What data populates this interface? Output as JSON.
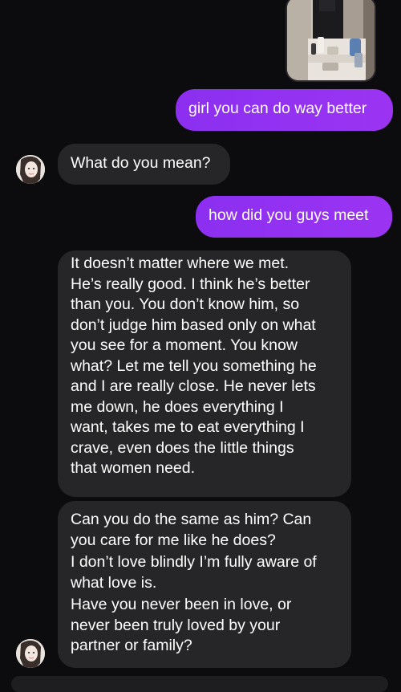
{
  "thread": {
    "messages": [
      {
        "from": "me",
        "text": "girl you can do way better"
      },
      {
        "from": "them",
        "text": "What do you mean?"
      },
      {
        "from": "me",
        "text": "how did you guys meet"
      },
      {
        "from": "them",
        "lines": [
          "It doesn’t matter where we met.",
          "He’s really good. I think he’s better",
          "than you. You don’t know him, so",
          "don’t judge him based only on what",
          "you see for a moment. You know",
          "what? Let me tell you something he",
          "and I are really close. He never lets",
          "me down, he does everything I",
          "want, takes me to eat everything I",
          "crave, even does the little things",
          "that women need."
        ]
      },
      {
        "from": "them",
        "paragraphs": [
          [
            "Can you do the same as him? Can",
            "you care for me like he does?"
          ],
          [
            "I don’t love blindly I’m fully aware of",
            "what love is."
          ],
          [
            "Have you never been in love, or",
            "never been truly loved by your",
            "partner or family?"
          ]
        ]
      }
    ]
  },
  "colors": {
    "background": "#0c0c0e",
    "sent_bubble": "#9130f0",
    "received_bubble": "#262629"
  }
}
